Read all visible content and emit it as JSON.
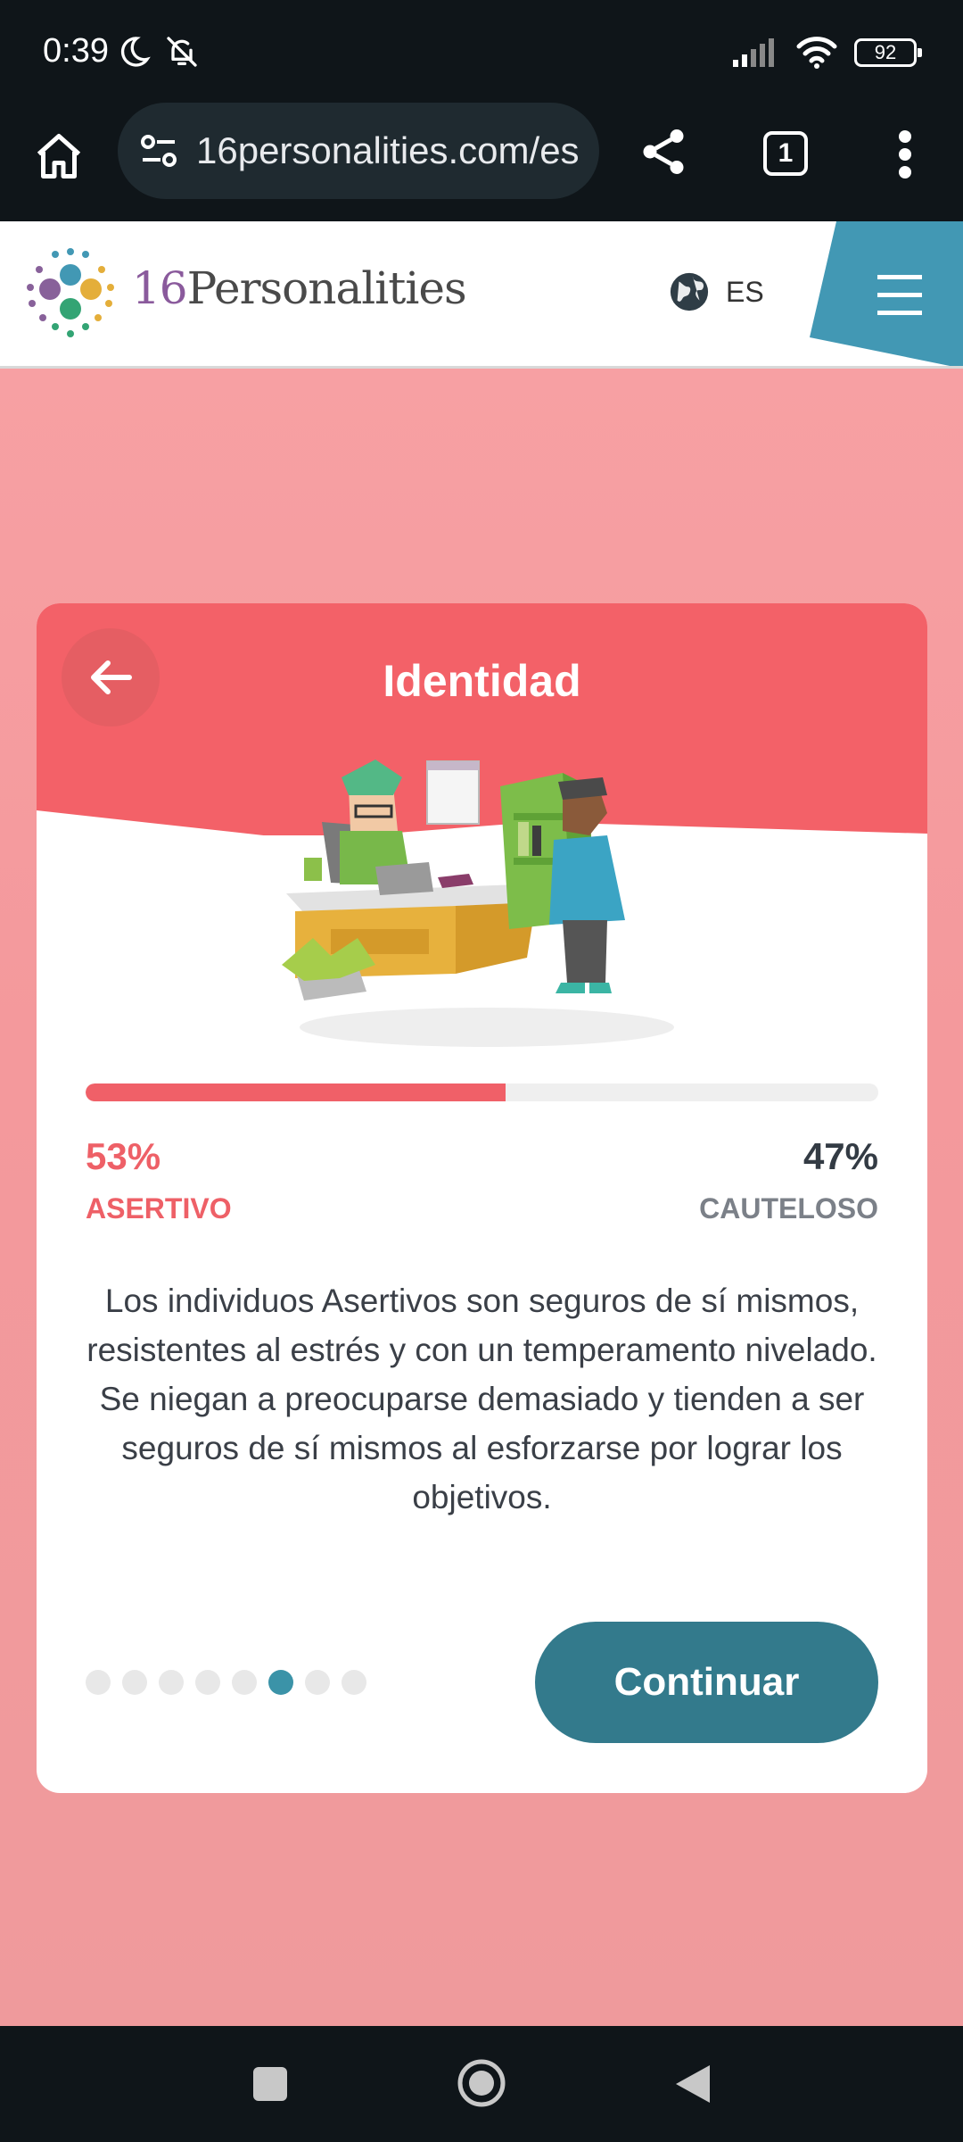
{
  "status_bar": {
    "time": "0:39",
    "battery": "92"
  },
  "browser": {
    "url": "16personalities.com/es",
    "tab_count": "1"
  },
  "site_header": {
    "logo_num": "16",
    "logo_name": "Personalities",
    "language": "ES"
  },
  "card": {
    "title": "Identidad",
    "progress_percent": 53,
    "left_percent": "53%",
    "left_label": "ASERTIVO",
    "right_percent": "47%",
    "right_label": "CAUTELOSO",
    "description": "Los individuos Asertivos son seguros de sí mismos, resistentes al estrés y con un temperamento nivelado. Se niegan a preocuparse demasiado y tienden a ser seguros de sí mismos al esforzarse por lograr los objetivos.",
    "pagination": {
      "total": 8,
      "active_index": 5
    },
    "continue_label": "Continuar"
  },
  "colors": {
    "accent_red": "#f06068",
    "button_teal": "#337a8c",
    "active_dot": "#3b93a8",
    "page_bg": "#f7a0a3"
  },
  "icons": [
    "home-icon",
    "tune-icon",
    "share-icon",
    "more-vert-icon",
    "globe-icon",
    "hamburger-menu-icon",
    "arrow-left-icon",
    "moon-icon",
    "bell-off-icon",
    "signal-icon",
    "wifi-icon"
  ]
}
